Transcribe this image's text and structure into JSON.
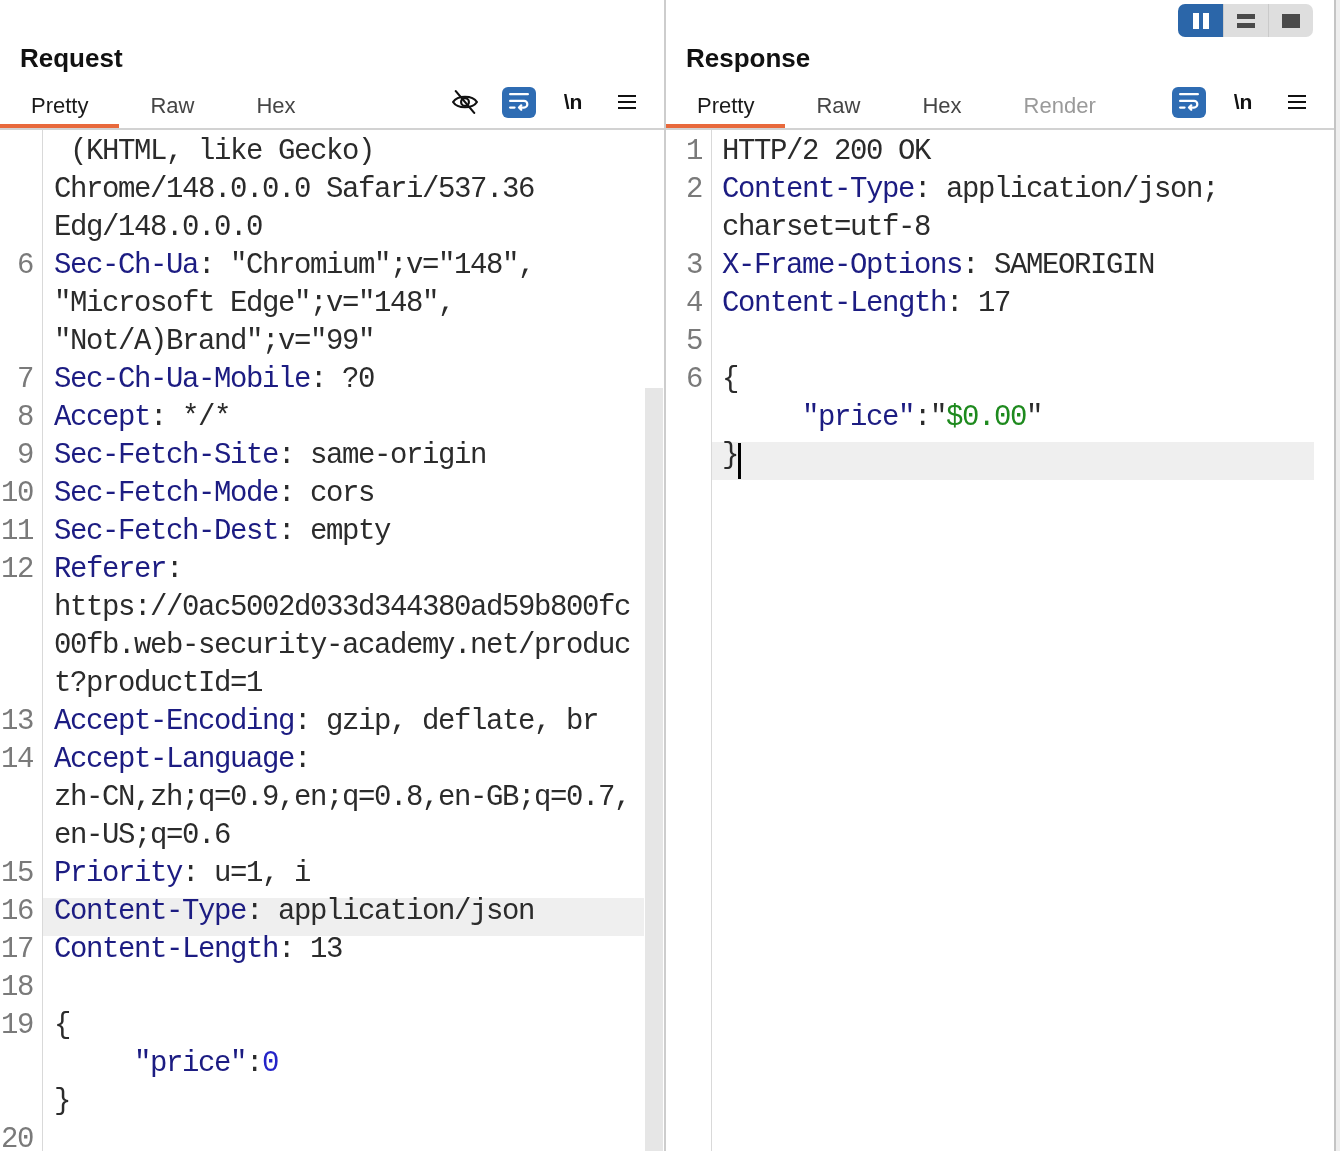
{
  "layout_toggle": [
    {
      "kind": "columns",
      "selected": true
    },
    {
      "kind": "rows",
      "selected": false
    },
    {
      "kind": "single",
      "selected": false
    }
  ],
  "request": {
    "title": "Request",
    "tabs": [
      {
        "label": "Pretty",
        "selected": true,
        "disabled": false
      },
      {
        "label": "Raw",
        "selected": false,
        "disabled": false
      },
      {
        "label": "Hex",
        "selected": false,
        "disabled": false
      }
    ],
    "toolbar": [
      {
        "kind": "hide"
      },
      {
        "kind": "wrap",
        "on": true
      },
      {
        "kind": "newline",
        "label": "\\n",
        "on": false
      },
      {
        "kind": "menu"
      }
    ],
    "editor": {
      "rows": [
        {
          "segments": [
            {
              "kind": "plain",
              "text": " (KHTML, like Gecko)"
            }
          ],
          "current": false,
          "caret": false
        },
        {
          "segments": [
            {
              "kind": "plain",
              "text": "Chrome/148.0.0.0 Safari/537.36"
            }
          ],
          "current": false,
          "caret": false
        },
        {
          "segments": [
            {
              "kind": "plain",
              "text": "Edg/148.0.0.0"
            }
          ],
          "current": false,
          "caret": false
        },
        {
          "number": "6",
          "segments": [
            {
              "kind": "key",
              "text": "Sec-Ch-Ua"
            },
            {
              "kind": "plain",
              "text": ": \"Chromium\";v=\"148\","
            }
          ],
          "current": false,
          "caret": false
        },
        {
          "segments": [
            {
              "kind": "plain",
              "text": "\"Microsoft Edge\";v=\"148\","
            }
          ],
          "current": false,
          "caret": false
        },
        {
          "segments": [
            {
              "kind": "plain",
              "text": "\"Not/A)Brand\";v=\"99\""
            }
          ],
          "current": false,
          "caret": false
        },
        {
          "number": "7",
          "segments": [
            {
              "kind": "key",
              "text": "Sec-Ch-Ua-Mobile"
            },
            {
              "kind": "plain",
              "text": ": ?0"
            }
          ],
          "current": false,
          "caret": false
        },
        {
          "number": "8",
          "segments": [
            {
              "kind": "key",
              "text": "Accept"
            },
            {
              "kind": "plain",
              "text": ": */*"
            }
          ],
          "current": false,
          "caret": false
        },
        {
          "number": "9",
          "segments": [
            {
              "kind": "key",
              "text": "Sec-Fetch-Site"
            },
            {
              "kind": "plain",
              "text": ": same-origin"
            }
          ],
          "current": false,
          "caret": false
        },
        {
          "number": "10",
          "segments": [
            {
              "kind": "key",
              "text": "Sec-Fetch-Mode"
            },
            {
              "kind": "plain",
              "text": ": cors"
            }
          ],
          "current": false,
          "caret": false
        },
        {
          "number": "11",
          "segments": [
            {
              "kind": "key",
              "text": "Sec-Fetch-Dest"
            },
            {
              "kind": "plain",
              "text": ": empty"
            }
          ],
          "current": false,
          "caret": false
        },
        {
          "number": "12",
          "segments": [
            {
              "kind": "key",
              "text": "Referer"
            },
            {
              "kind": "plain",
              "text": ":"
            }
          ],
          "current": false,
          "caret": false
        },
        {
          "segments": [
            {
              "kind": "plain",
              "text": "https://0ac5002d033d344380ad59b800fc"
            }
          ],
          "current": false,
          "caret": false
        },
        {
          "segments": [
            {
              "kind": "plain",
              "text": "00fb.web-security-academy.net/produc"
            }
          ],
          "current": false,
          "caret": false
        },
        {
          "segments": [
            {
              "kind": "plain",
              "text": "t?productId=1"
            }
          ],
          "current": false,
          "caret": false
        },
        {
          "number": "13",
          "segments": [
            {
              "kind": "key",
              "text": "Accept-Encoding"
            },
            {
              "kind": "plain",
              "text": ": gzip, deflate, br"
            }
          ],
          "current": false,
          "caret": false
        },
        {
          "number": "14",
          "segments": [
            {
              "kind": "key",
              "text": "Accept-Language"
            },
            {
              "kind": "plain",
              "text": ":"
            }
          ],
          "current": false,
          "caret": false
        },
        {
          "segments": [
            {
              "kind": "plain",
              "text": "zh-CN,zh;q=0.9,en;q=0.8,en-GB;q=0.7,"
            }
          ],
          "current": false,
          "caret": false
        },
        {
          "segments": [
            {
              "kind": "plain",
              "text": "en-US;q=0.6"
            }
          ],
          "current": false,
          "caret": false
        },
        {
          "number": "15",
          "segments": [
            {
              "kind": "key",
              "text": "Priority"
            },
            {
              "kind": "plain",
              "text": ": u=1, i"
            }
          ],
          "current": false,
          "caret": false
        },
        {
          "number": "16",
          "segments": [
            {
              "kind": "key",
              "text": "Content-Type"
            },
            {
              "kind": "plain",
              "text": ": application/json"
            }
          ],
          "current": true,
          "caret": false
        },
        {
          "number": "17",
          "segments": [
            {
              "kind": "key",
              "text": "Content-Length"
            },
            {
              "kind": "plain",
              "text": ": 13"
            }
          ],
          "current": false,
          "caret": false
        },
        {
          "number": "18",
          "current": false,
          "caret": false
        },
        {
          "number": "19",
          "segments": [
            {
              "kind": "plain",
              "text": "{"
            }
          ],
          "current": false,
          "caret": false
        },
        {
          "indent": "     ",
          "segments": [
            {
              "kind": "key",
              "text": "\"price\""
            },
            {
              "kind": "plain",
              "text": ":"
            },
            {
              "kind": "number",
              "text": "0"
            }
          ],
          "current": false,
          "caret": false
        },
        {
          "segments": [
            {
              "kind": "plain",
              "text": "}"
            }
          ],
          "current": false,
          "caret": false
        },
        {
          "number": "20",
          "current": false,
          "caret": false
        }
      ]
    }
  },
  "response": {
    "title": "Response",
    "tabs": [
      {
        "label": "Pretty",
        "selected": true,
        "disabled": false
      },
      {
        "label": "Raw",
        "selected": false,
        "disabled": false
      },
      {
        "label": "Hex",
        "selected": false,
        "disabled": false
      },
      {
        "label": "Render",
        "selected": false,
        "disabled": true
      }
    ],
    "toolbar": [
      {
        "kind": "wrap",
        "on": true
      },
      {
        "kind": "newline",
        "label": "\\n",
        "on": false
      },
      {
        "kind": "menu"
      }
    ],
    "editor": {
      "rows": [
        {
          "number": "1",
          "segments": [
            {
              "kind": "plain",
              "text": "HTTP/2 200 OK"
            }
          ],
          "current": false,
          "caret": false
        },
        {
          "number": "2",
          "segments": [
            {
              "kind": "key",
              "text": "Content-Type"
            },
            {
              "kind": "plain",
              "text": ": application/json;"
            }
          ],
          "current": false,
          "caret": false
        },
        {
          "segments": [
            {
              "kind": "plain",
              "text": "charset=utf-8"
            }
          ],
          "current": false,
          "caret": false
        },
        {
          "number": "3",
          "segments": [
            {
              "kind": "key",
              "text": "X-Frame-Options"
            },
            {
              "kind": "plain",
              "text": ": SAMEORIGIN"
            }
          ],
          "current": false,
          "caret": false
        },
        {
          "number": "4",
          "segments": [
            {
              "kind": "key",
              "text": "Content-Length"
            },
            {
              "kind": "plain",
              "text": ": 17"
            }
          ],
          "current": false,
          "caret": false
        },
        {
          "number": "5",
          "current": false,
          "caret": false
        },
        {
          "number": "6",
          "segments": [
            {
              "kind": "plain",
              "text": "{"
            }
          ],
          "current": false,
          "caret": false
        },
        {
          "indent": "     ",
          "segments": [
            {
              "kind": "key",
              "text": "\"price\""
            },
            {
              "kind": "plain",
              "text": ":\""
            },
            {
              "kind": "string",
              "text": "$0.00"
            },
            {
              "kind": "plain",
              "text": "\""
            }
          ],
          "current": false,
          "caret": false
        },
        {
          "segments": [
            {
              "kind": "plain",
              "text": "}"
            }
          ],
          "current": true,
          "caret": true
        }
      ]
    }
  }
}
